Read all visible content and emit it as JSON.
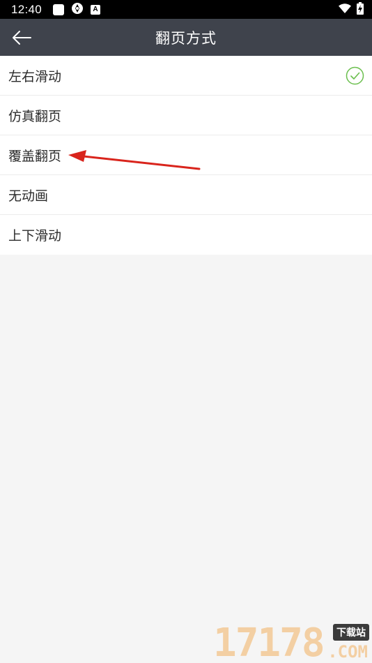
{
  "status_bar": {
    "time": "12:40",
    "left_icons": [
      "notification-square-icon",
      "app-notification-icon",
      "accessibility-a-icon"
    ],
    "right_icons": [
      "wifi-icon",
      "battery-charging-icon"
    ]
  },
  "app_bar": {
    "title": "翻页方式",
    "background": "#3f434c"
  },
  "options": [
    {
      "label": "左右滑动",
      "selected": true
    },
    {
      "label": "仿真翻页",
      "selected": false
    },
    {
      "label": "覆盖翻页",
      "selected": false
    },
    {
      "label": "无动画",
      "selected": false
    },
    {
      "label": "上下滑动",
      "selected": false
    }
  ],
  "colors": {
    "check": "#6bbf4e",
    "annotation_arrow": "#d9241c"
  },
  "watermark": {
    "digits": "17178",
    "badge": "下载站",
    "suffix": ".COM"
  }
}
